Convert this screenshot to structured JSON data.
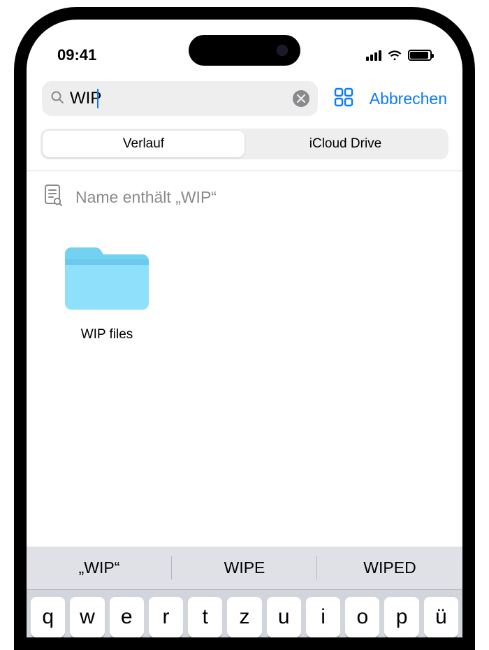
{
  "status": {
    "time": "09:41"
  },
  "nav": {
    "search_value": "WIP",
    "cancel_label": "Abbrechen"
  },
  "scope": {
    "tabs": [
      {
        "label": "Verlauf",
        "active": true
      },
      {
        "label": "iCloud Drive",
        "active": false
      }
    ]
  },
  "suggestion": {
    "text": "Name enthält „WIP“"
  },
  "results": {
    "items": [
      {
        "type": "folder",
        "name": "WIP files"
      }
    ]
  },
  "keyboard": {
    "predictions": [
      "„WIP“",
      "WIPE",
      "WIPED"
    ],
    "row1": [
      "q",
      "w",
      "e",
      "r",
      "t",
      "z",
      "u",
      "i",
      "o",
      "p",
      "ü"
    ]
  }
}
